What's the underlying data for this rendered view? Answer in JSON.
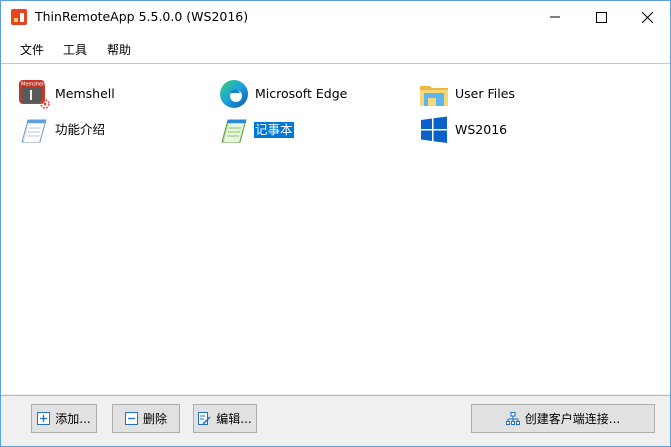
{
  "window": {
    "title": "ThinRemoteApp  5.5.0.0 (WS2016)"
  },
  "menu": [
    "文件",
    "工具",
    "帮助"
  ],
  "apps": [
    {
      "label": "Memshell",
      "icon": "memshell-icon",
      "badge": "Memshell"
    },
    {
      "label": "Microsoft Edge",
      "icon": "edge-icon"
    },
    {
      "label": "User Files",
      "icon": "folder-icon"
    },
    {
      "label": "功能介绍",
      "icon": "notepad-icon"
    },
    {
      "label": "记事本",
      "icon": "notepad-icon",
      "selected": true
    },
    {
      "label": "WS2016",
      "icon": "windows-logo-icon"
    }
  ],
  "buttons": {
    "add": "添加...",
    "delete": "删除",
    "edit": "编辑...",
    "create_connection": "创建客户端连接..."
  },
  "colors": {
    "selection": "#0078d7",
    "accent": "#1e70c8"
  }
}
